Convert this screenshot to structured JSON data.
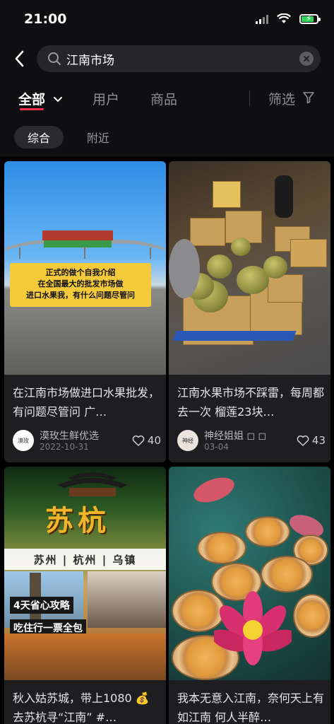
{
  "status_bar": {
    "time": "21:00"
  },
  "search": {
    "query": "江南市场"
  },
  "tabs": [
    "全部",
    "用户",
    "商品"
  ],
  "filter_label": "筛选",
  "chips": [
    "综合",
    "附近"
  ],
  "posts": [
    {
      "title": "在江南市场做进口水果批发，有问题尽管问 广…",
      "author": "漠玫生鲜优选",
      "date": "2022-10-31",
      "likes": "40",
      "avatar_text": "漠玫",
      "image_text": [
        "正式的做个自我介绍",
        "在全国最大的批发市场做",
        "进口水果我，有什么问题尽管问"
      ]
    },
    {
      "title": "江南水果市场不踩雷，每周都去一次 榴莲23块…",
      "author": "神经姐姐 ◻ ◻",
      "date": "03-04",
      "likes": "43",
      "avatar_text": "神经"
    },
    {
      "title": "秋入姑苏城，带上1080 💰 去苏杭寻“江南” #…",
      "image_title": "苏杭",
      "image_band": "苏州 | 杭州 | 乌镇",
      "image_tag1": "4天省心攻略",
      "image_tag2": "吃住行一票全包"
    },
    {
      "title": "我本无意入江南，奈何天上有如江南 何人半醉…"
    }
  ],
  "colors": {
    "accent": "#ff2e4d",
    "background": "#0f0f11",
    "card": "#1e1e21"
  }
}
